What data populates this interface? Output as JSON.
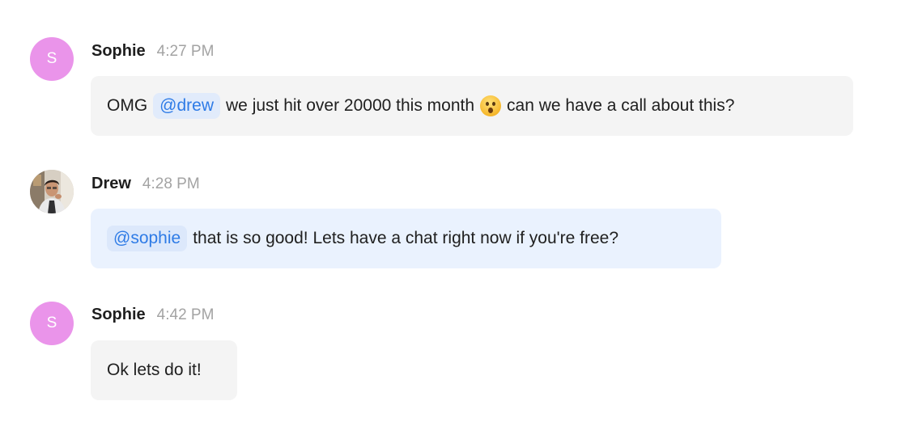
{
  "messages": [
    {
      "author": "Sophie",
      "avatar_letter": "S",
      "time": "4:27 PM",
      "mention": "@drew",
      "text_before": "OMG",
      "text_middle": "we just hit over 20000 this month",
      "emoji": "astonished-face-emoji",
      "text_after": "can we have a call about this?"
    },
    {
      "author": "Drew",
      "avatar": "profile-photo",
      "time": "4:28 PM",
      "mention": "@sophie",
      "text": "that is so good! Lets have a chat right now if you're free?"
    },
    {
      "author": "Sophie",
      "avatar_letter": "S",
      "time": "4:42 PM",
      "text": "Ok lets do it!"
    }
  ],
  "colors": {
    "sophie_avatar": "#ea94ea",
    "mention_text": "#2e7be6",
    "bubble_grey": "#f4f4f4",
    "bubble_blue": "#eaf2fe",
    "timestamp": "#a3a3a3"
  }
}
